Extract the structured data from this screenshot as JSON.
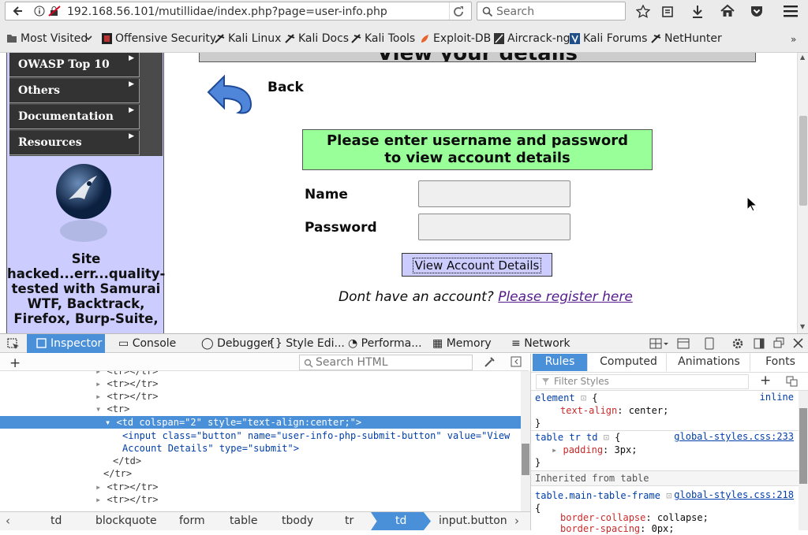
{
  "browser": {
    "url": "192.168.56.101/mutillidae/index.php?page=user-info.php",
    "search_placeholder": "Search"
  },
  "bookmarks": [
    "Most Visited",
    "Offensive Security",
    "Kali Linux",
    "Kali Docs",
    "Kali Tools",
    "Exploit-DB",
    "Aircrack-ng",
    "Kali Forums",
    "NetHunter"
  ],
  "sidebar": {
    "menu": [
      "OWASP Top 10",
      "Others",
      "Documentation",
      "Resources"
    ],
    "hacked_text": "Site hacked...err...quality-tested with Samurai WTF, Backtrack, Firefox, Burp-Suite,"
  },
  "main": {
    "title": "View your details",
    "back_label": "Back",
    "instructions_line1": "Please enter username and password",
    "instructions_line2": "to view account details",
    "name_label": "Name",
    "password_label": "Password",
    "submit_label": "View Account Details",
    "register_prefix": "Dont have an account?",
    "register_link": "Please register here"
  },
  "devtools": {
    "tabs": [
      "Inspector",
      "Console",
      "Debugger",
      "Style Edi...",
      "Performa...",
      "Memory",
      "Network"
    ],
    "search_html_placeholder": "Search HTML",
    "markup": {
      "row_a": "<tr></tr>",
      "tr_open": "<tr>",
      "td_line": "<td colspan=\"2\" style=\"text-align:center;\">",
      "input_line1": "<input class=\"button\" name=\"user-info-php-submit-button\" value=\"View",
      "input_line2": "Account Details\" type=\"submit\">",
      "td_close": "</td>",
      "tr_close": "</tr>"
    },
    "breadcrumb": [
      "td",
      "blockquote",
      "form",
      "table",
      "tbody",
      "tr",
      "td",
      "input.button"
    ],
    "rules_tabs": [
      "Rules",
      "Computed",
      "Animations",
      "Fonts"
    ],
    "filter_placeholder": "Filter Styles",
    "rules": {
      "r1_selector": "element",
      "r1_source": "inline",
      "r1_prop": "text-align",
      "r1_value": "center",
      "r2_selector": "table tr td",
      "r2_source": "global-styles.css:233",
      "r2_prop": "padding",
      "r2_value": "3px",
      "inherited": "Inherited from table",
      "r3_selector": "table.main-table-frame",
      "r3_source": "global-styles.css:218",
      "r3_prop1": "border-collapse",
      "r3_value1": "collapse",
      "r3_prop2": "border-spacing",
      "r3_value2": "0px"
    }
  }
}
